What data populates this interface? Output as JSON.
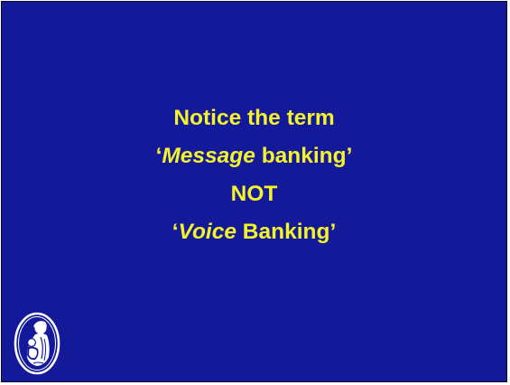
{
  "slide": {
    "background_color": "#14199a",
    "text_color": "#f4f42a",
    "lines": [
      {
        "text": "Notice the term"
      },
      {
        "open_quote": "‘",
        "emphasis": "Message",
        "rest": " banking’"
      },
      {
        "text": "NOT"
      },
      {
        "open_quote": "‘",
        "emphasis": "Voice",
        "rest": " Banking’"
      }
    ],
    "logo": {
      "icon": "mother-and-child-emblem-icon"
    }
  }
}
